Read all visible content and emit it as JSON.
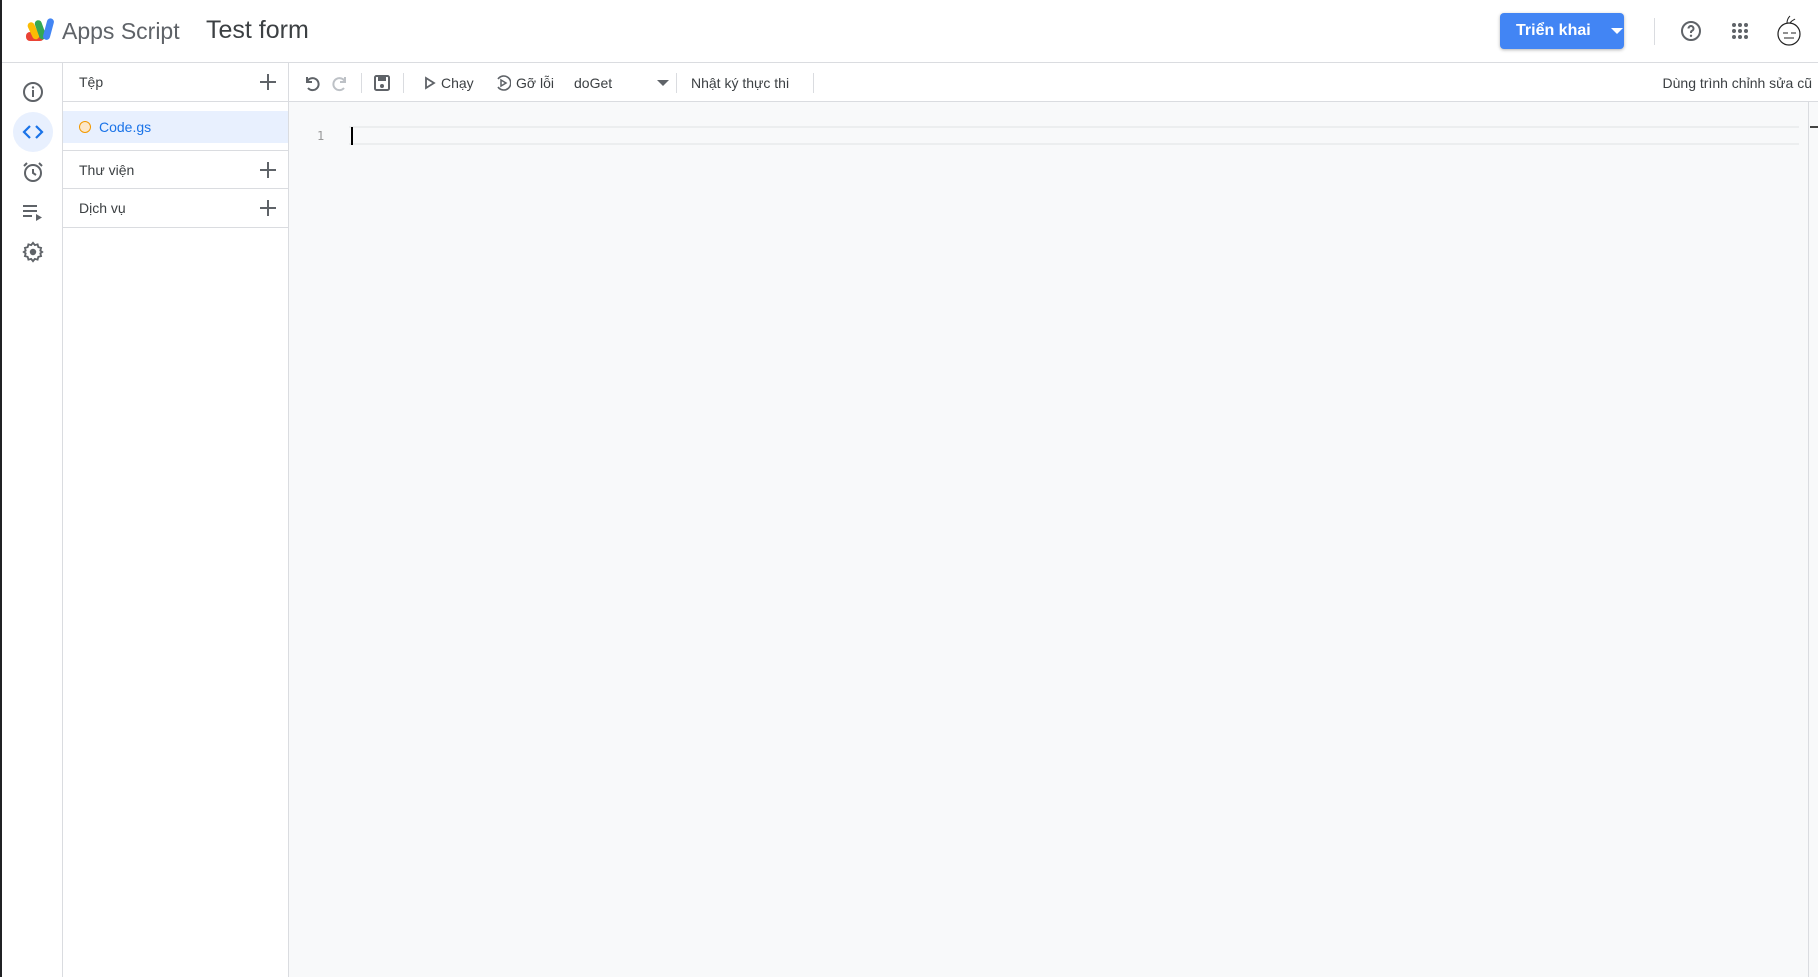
{
  "header": {
    "app_name": "Apps Script",
    "project_title": "Test form",
    "deploy_label": "Triển khai"
  },
  "rail": {
    "items": [
      "info",
      "editor",
      "triggers",
      "executions",
      "settings"
    ]
  },
  "panel": {
    "files_label": "Tệp",
    "file_name": "Code.gs",
    "libraries_label": "Thư viện",
    "services_label": "Dịch vụ"
  },
  "toolbar": {
    "run_label": "Chạy",
    "debug_label": "Gỡ lỗi",
    "function_select": "doGet",
    "log_label": "Nhật ký thực thi",
    "legacy_label": "Dùng trình chỉnh sửa cũ"
  },
  "editor": {
    "line_number": "1"
  },
  "colors": {
    "accent": "#4285f4",
    "selected": "#e8f0fe",
    "file_dot": "#f29900"
  }
}
